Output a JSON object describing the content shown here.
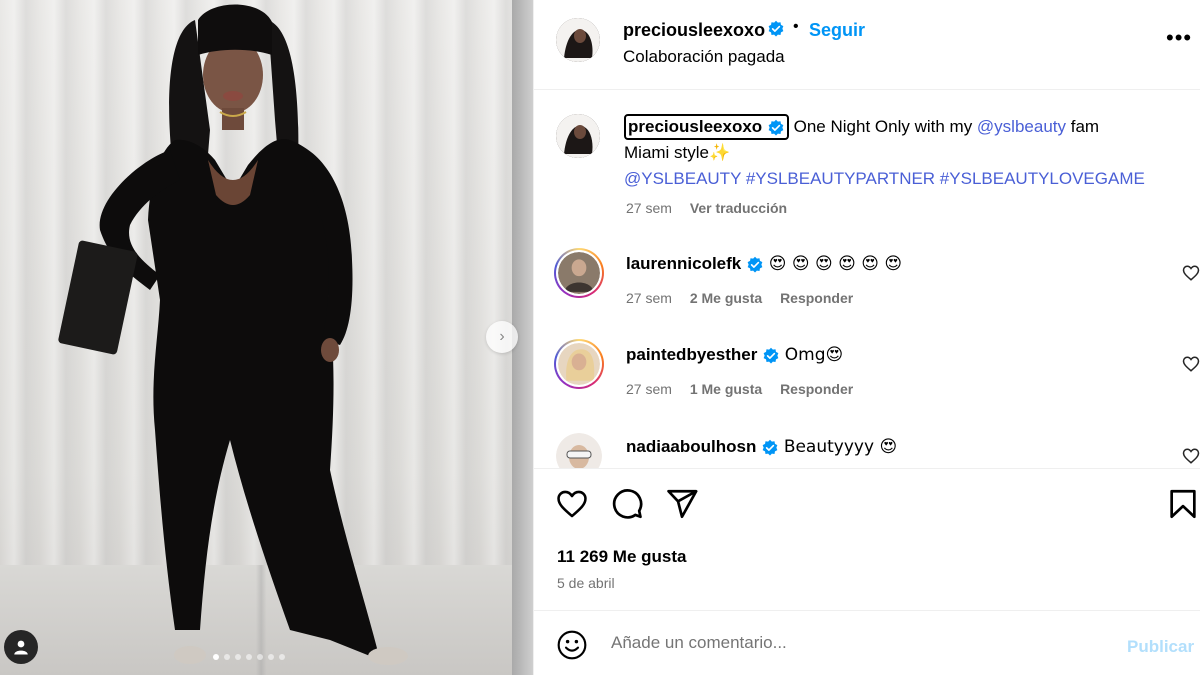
{
  "post": {
    "author": "preciouslee xoxo",
    "username": "preciousleexoxo",
    "follow_label": "Seguir",
    "dot_separator": "•",
    "subtitle": "Colaboración pagada",
    "more_label": "•••"
  },
  "media": {
    "dots_total": 7,
    "dots_active": 0,
    "next_label": "›"
  },
  "caption": {
    "user": "preciousleexoxo",
    "text_1": " One Night Only with my ",
    "mention": "@yslbeauty",
    "text_2": " fam",
    "line_2": "Miami style",
    "sparkle": "✨",
    "tags": "@YSLBEAUTY #YSLBEAUTYPARTNER #YSLBEAUTYLOVEGAME",
    "time": "27 sem",
    "translate": "Ver traducción"
  },
  "comments": [
    {
      "user": "laurennicolefk",
      "text": "😍 😍 😍 😍 😍 😍",
      "time": "27 sem",
      "likes": "2 Me gusta",
      "reply": "Responder",
      "avatar_color": "#8a7a6a"
    },
    {
      "user": "paintedbyesther",
      "text": "Omg😍",
      "time": "27 sem",
      "likes": "1 Me gusta",
      "reply": "Responder",
      "avatar_color": "#d8b98a"
    },
    {
      "user": "nadiaaboulhosn",
      "text": "Beautyyyy 😍",
      "time": "",
      "likes": "",
      "reply": "",
      "avatar_color": "#c9c3bd"
    }
  ],
  "actions": {
    "likes_label": "11 269 Me gusta",
    "date": "5 de abril"
  },
  "composer": {
    "placeholder": "Añade un comentario...",
    "publish": "Publicar"
  },
  "colors": {
    "link": "#4a5fd6",
    "follow": "#0095f6",
    "verified": "#0095f6",
    "publish_disabled": "#b2dffc"
  }
}
